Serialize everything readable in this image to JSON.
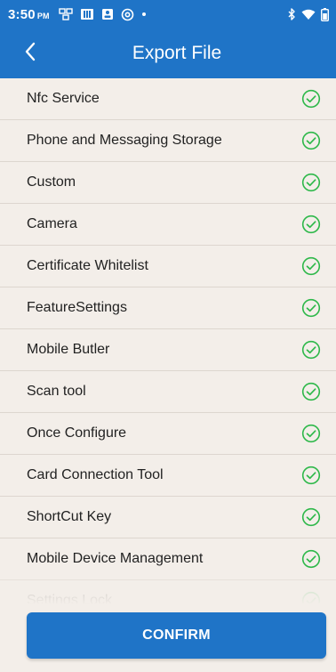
{
  "status_bar": {
    "time": "3:50",
    "ampm": "PM",
    "icons_left": [
      "sim-icon",
      "grid-icon",
      "portrait-icon",
      "at-icon",
      "dot-icon"
    ],
    "icons_right": [
      "bluetooth-icon",
      "wifi-icon",
      "battery-icon"
    ]
  },
  "app_bar": {
    "title": "Export File",
    "back_icon": "chevron-left-icon"
  },
  "list": {
    "items": [
      {
        "label": "Nfc Service",
        "checked": true
      },
      {
        "label": "Phone and Messaging Storage",
        "checked": true
      },
      {
        "label": "Custom",
        "checked": true
      },
      {
        "label": "Camera",
        "checked": true
      },
      {
        "label": "Certificate Whitelist",
        "checked": true
      },
      {
        "label": "FeatureSettings",
        "checked": true
      },
      {
        "label": "Mobile Butler",
        "checked": true
      },
      {
        "label": "Scan tool",
        "checked": true
      },
      {
        "label": "Once Configure",
        "checked": true
      },
      {
        "label": "Card Connection Tool",
        "checked": true
      },
      {
        "label": "ShortCut Key",
        "checked": true
      },
      {
        "label": "Mobile Device Management",
        "checked": true
      },
      {
        "label": "Settings Lock",
        "checked": true
      }
    ]
  },
  "confirm_button": {
    "label": "CONFIRM"
  },
  "colors": {
    "primary": "#1f74c7",
    "background": "#f3eee9",
    "check_green": "#2eb84a"
  }
}
